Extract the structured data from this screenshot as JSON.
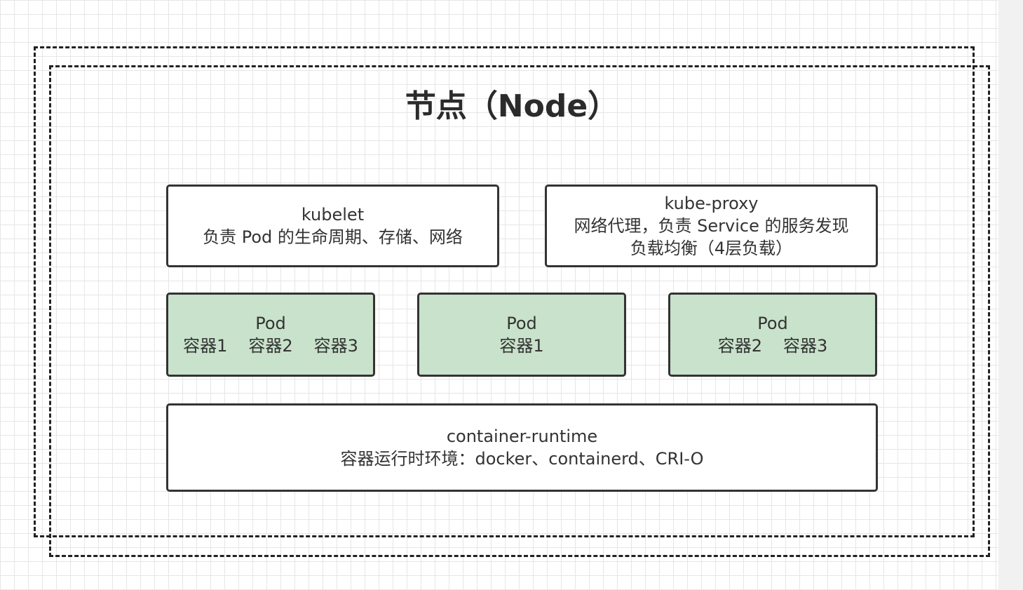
{
  "title": "节点（Node）",
  "components": {
    "kubelet": {
      "name": "kubelet",
      "description": "负责 Pod 的生命周期、存储、网络"
    },
    "kube_proxy": {
      "name": "kube-proxy",
      "description_line1": "网络代理，负责 Service 的服务发现",
      "description_line2": "负载均衡（4层负载）"
    },
    "container_runtime": {
      "name": "container-runtime",
      "description": "容器运行时环境：docker、containerd、CRI-O"
    }
  },
  "pods": [
    {
      "label": "Pod",
      "containers": [
        "容器1",
        "容器2",
        "容器3"
      ]
    },
    {
      "label": "Pod",
      "containers": [
        "容器1"
      ]
    },
    {
      "label": "Pod",
      "containers": [
        "容器2",
        "容器3"
      ]
    }
  ],
  "colors": {
    "pod_fill": "#c9e2cb",
    "box_border": "#333333",
    "frame_border": "#222222"
  }
}
